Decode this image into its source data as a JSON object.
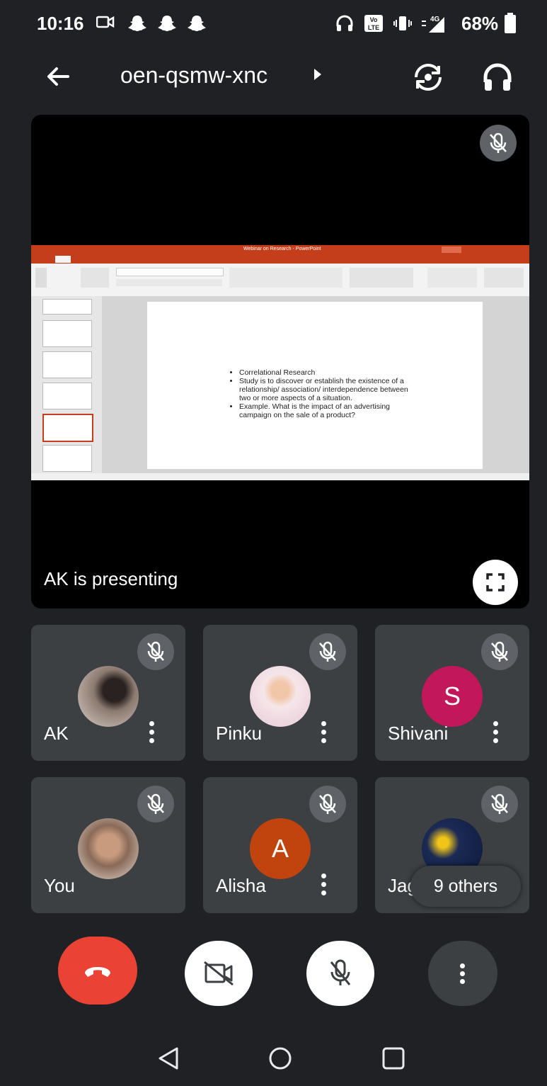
{
  "status_bar": {
    "time": "10:16",
    "network": "4G",
    "battery": "68%"
  },
  "header": {
    "meeting_code": "oen-qsmw-xnc"
  },
  "presentation": {
    "presenting_label": "AK is presenting",
    "app_title": "Webinar on Research - PowerPoint",
    "slide_bullets": [
      "Correlational Research",
      "Study is to discover or establish the existence of a relationship/ association/ interdependence between two or more aspects of a situation.",
      "Example. What is the impact of an advertising campaign on the sale of a product?"
    ]
  },
  "participants": [
    {
      "name": "AK",
      "avatar": "photo",
      "color": "#6d5d55"
    },
    {
      "name": "Pinku",
      "avatar": "photo",
      "color": "#e9d6d0"
    },
    {
      "name": "Shivani",
      "avatar": "letter",
      "letter": "S",
      "color": "#c2185b"
    },
    {
      "name": "You",
      "avatar": "photo",
      "color": "#9b7b68"
    },
    {
      "name": "Alisha",
      "avatar": "letter",
      "letter": "A",
      "color": "#c1440e"
    },
    {
      "name": "Jag",
      "avatar": "photo",
      "color": "#0d1a3a"
    }
  ],
  "others_label": "9 others",
  "colors": {
    "end_call": "#ea4335",
    "tile_bg": "#3c4043",
    "background": "#202124",
    "ppt_accent": "#c43e1c"
  },
  "icons": [
    "back-arrow-icon",
    "switch-camera-icon",
    "headphones-icon",
    "mic-off-icon",
    "fullscreen-icon",
    "more-vert-icon",
    "end-call-icon",
    "camera-off-icon"
  ]
}
